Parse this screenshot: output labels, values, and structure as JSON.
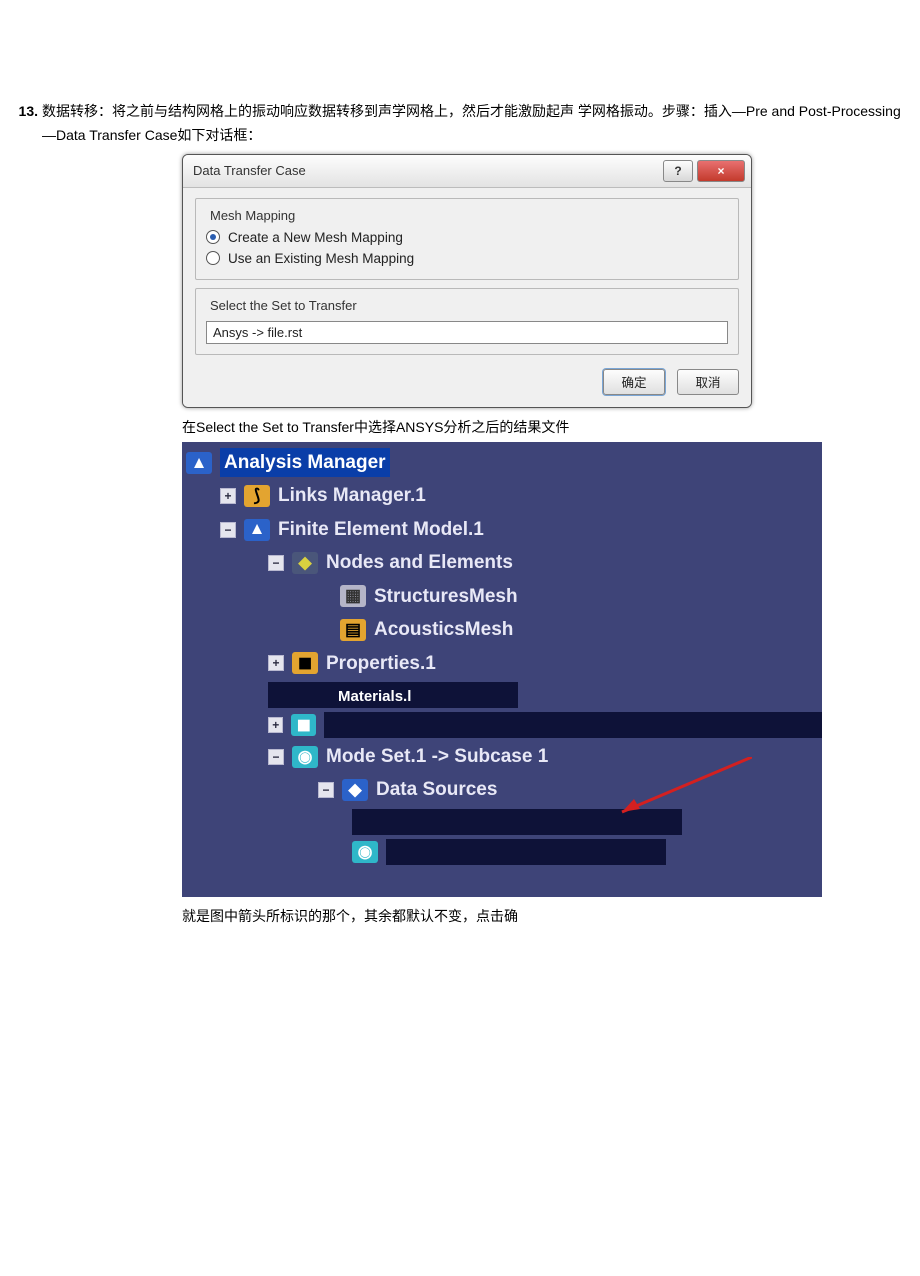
{
  "step": {
    "number": "13.",
    "text_line1": "数据转移：将之前与结构网格上的振动响应数据转移到声学网格上，然后才能激励起声  学网格振动。步骤：插入—Pre and Post-Processing—Data Transfer Case如下对话框："
  },
  "dialog": {
    "title": "Data Transfer Case",
    "help_btn": "?",
    "close_btn": "×",
    "group_mapping_legend": "Mesh Mapping",
    "radio_create": "Create a New Mesh Mapping",
    "radio_existing": "Use an Existing Mesh Mapping",
    "group_select_legend": "Select the Set to Transfer",
    "select_value": "Ansys -> file.rst",
    "ok": "确定",
    "cancel": "取消"
  },
  "caption1": "在Select the Set to Transfer中选择ANSYS分析之后的结果文件",
  "tree": {
    "analysis_manager": "Analysis Manager",
    "links_manager": "Links Manager.1",
    "fem": "Finite Element Model.1",
    "nodes_elements": "Nodes and Elements",
    "struct_mesh": "StructuresMesh",
    "acoustics_mesh": "AcousticsMesh",
    "properties": "Properties.1",
    "materials": "Materials.l",
    "mode_set": "Mode Set.1 -> Subcase 1",
    "data_sources": "Data Sources"
  },
  "caption2": "就是图中箭头所标识的那个，其余都默认不变，点击确"
}
